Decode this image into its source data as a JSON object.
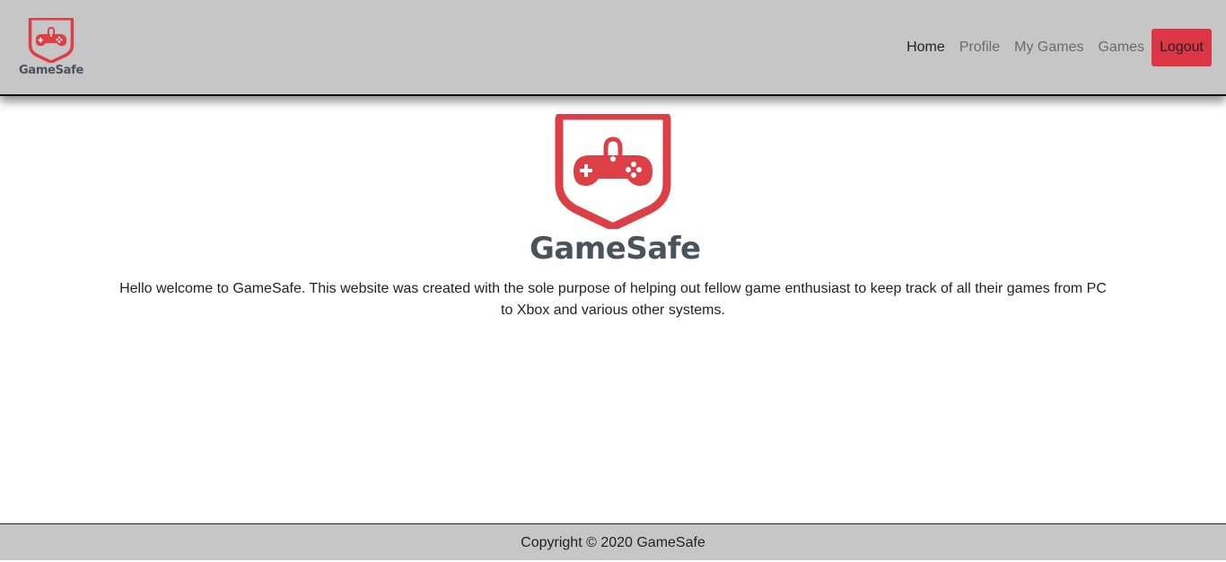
{
  "brand": {
    "name": "GameSafe",
    "logo_icon": "shield-gamepad-lock-icon",
    "logo_color": "#dc3f45",
    "text_color": "#4a525c"
  },
  "nav": {
    "items": [
      {
        "label": "Home",
        "active": true
      },
      {
        "label": "Profile",
        "active": false
      },
      {
        "label": "My Games",
        "active": false
      },
      {
        "label": "Games",
        "active": false
      }
    ],
    "logout_label": "Logout",
    "logout_color": "#dc3545"
  },
  "hero": {
    "title": "GameSafe",
    "welcome_text": "Hello welcome to GameSafe. This website was created with the sole purpose of helping out fellow game enthusiast to keep track of all their games from PC to Xbox and various other systems."
  },
  "footer": {
    "copyright": "Copyright © 2020 GameSafe"
  },
  "colors": {
    "navbar_bg": "#c6c6c6",
    "page_bg": "#ffffff"
  }
}
